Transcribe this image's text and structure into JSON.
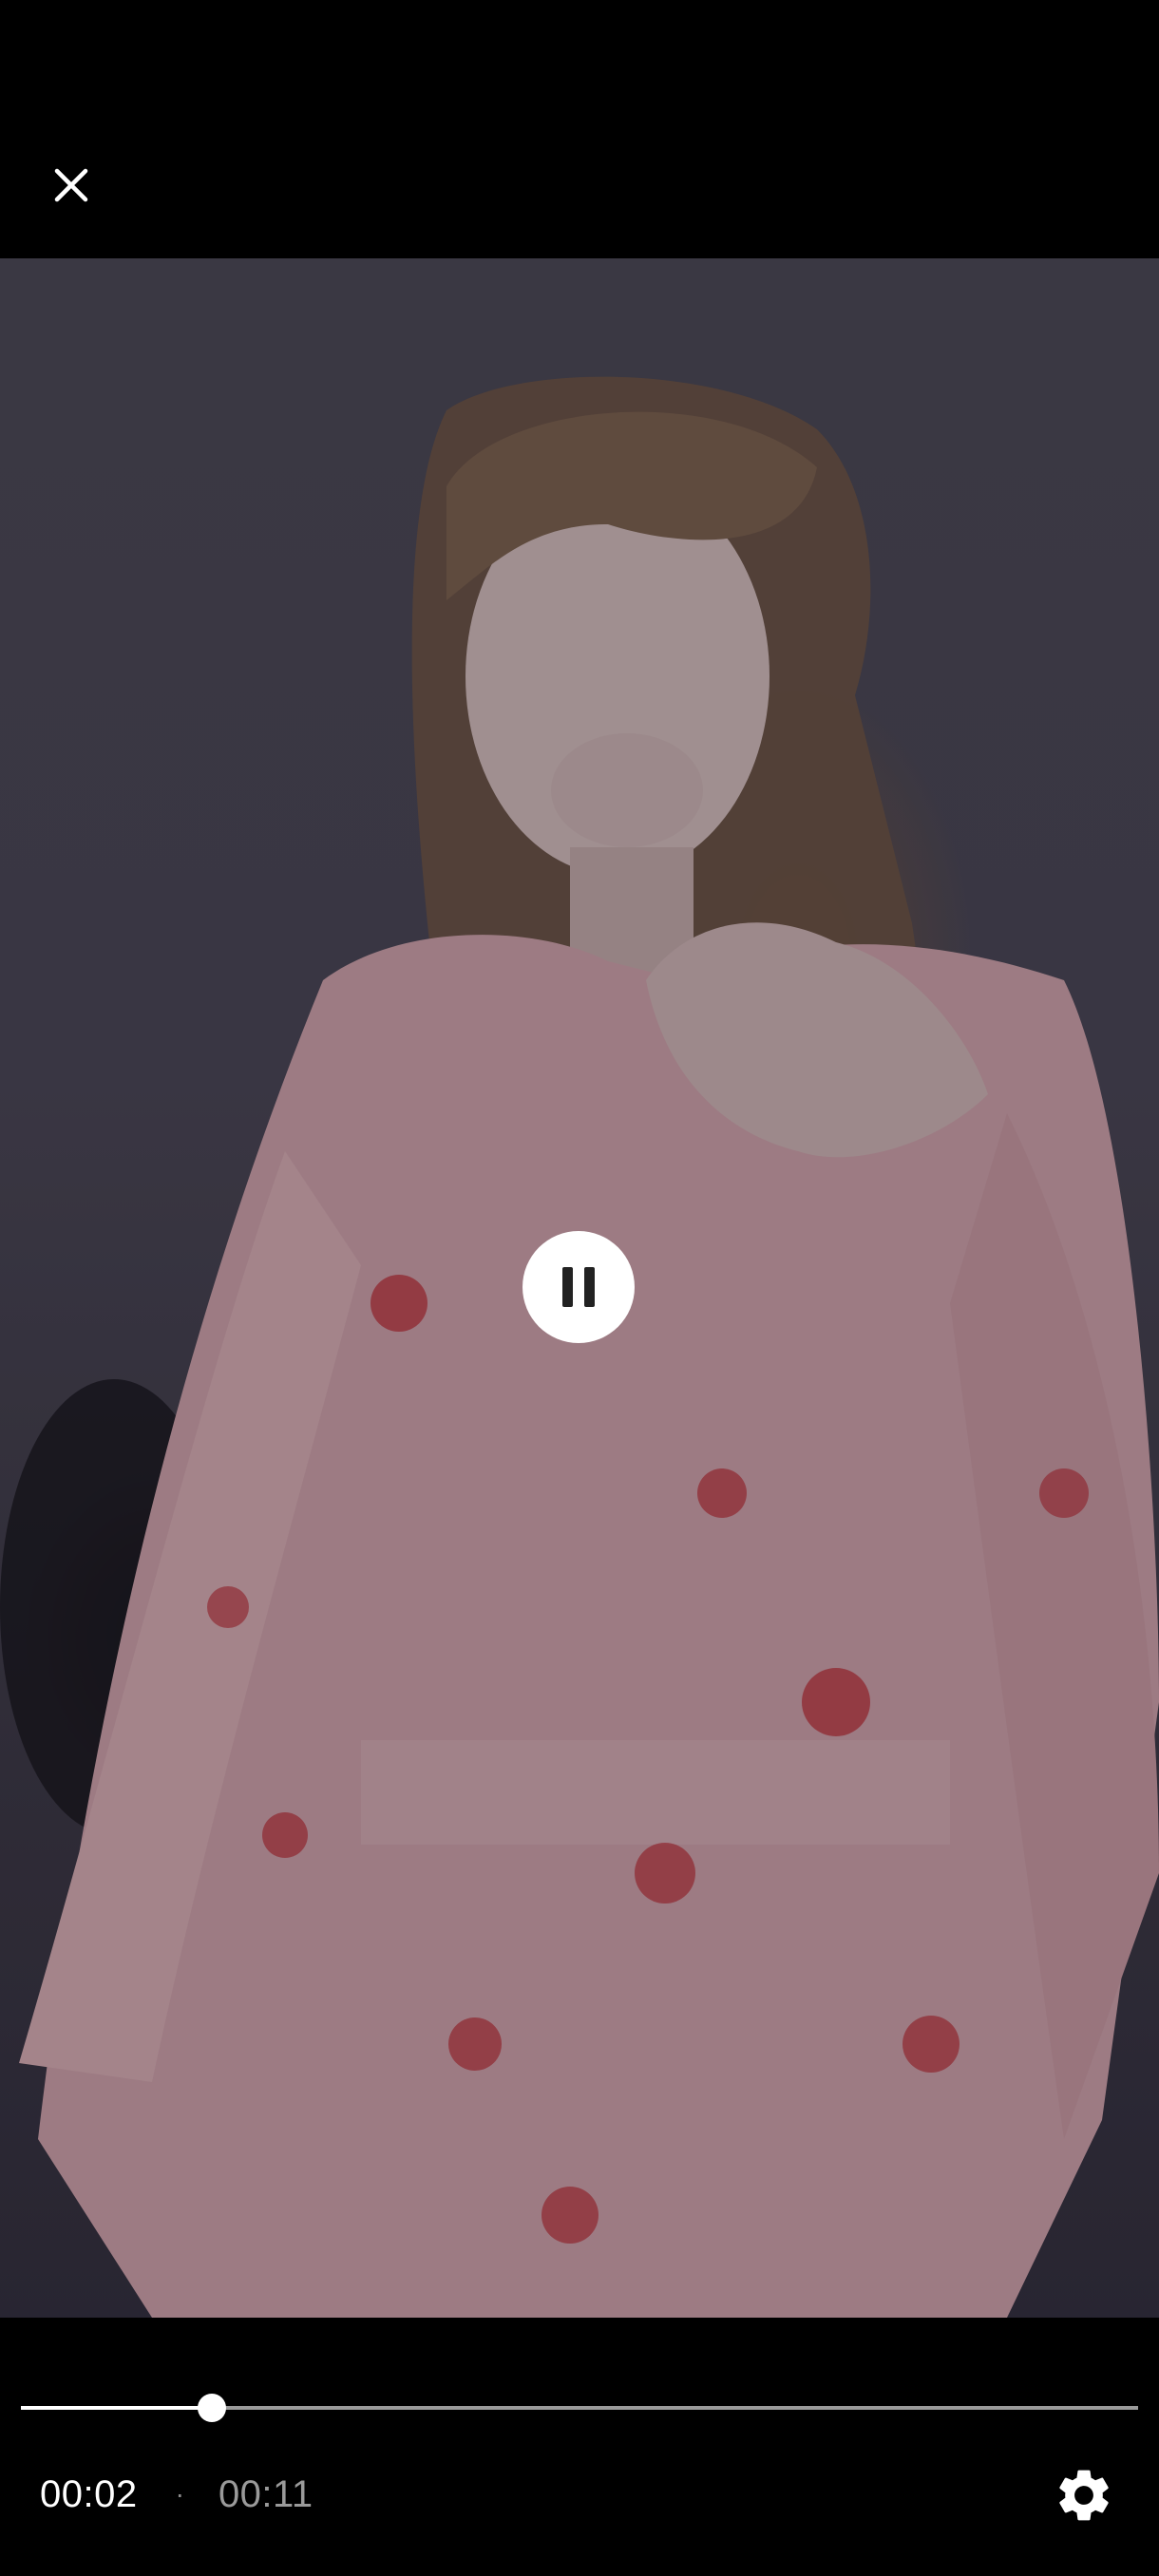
{
  "player": {
    "close_icon": "close-icon",
    "center_control_icon": "pause-icon",
    "settings_icon": "gear-icon"
  },
  "playback": {
    "current_time": "00:02",
    "separator": "·",
    "total_time": "00:11",
    "progress": 0.171
  }
}
